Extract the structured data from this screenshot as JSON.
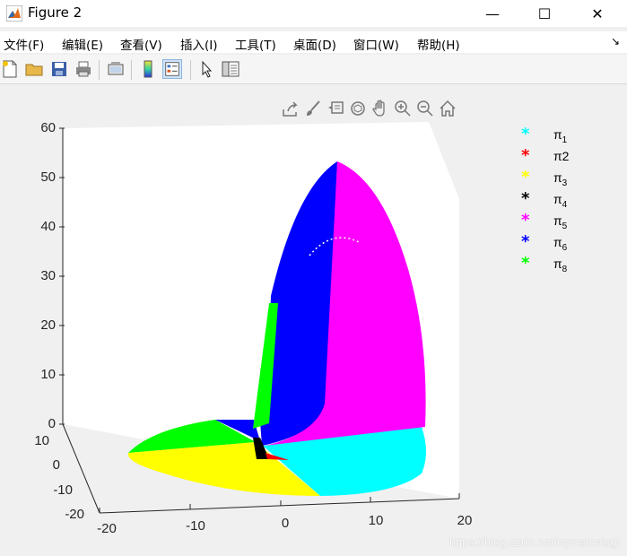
{
  "window": {
    "title": "Figure 2",
    "minimize": "—",
    "maximize": "☐",
    "close": "✕"
  },
  "menubar": {
    "items": [
      {
        "label": "文件(F)"
      },
      {
        "label": "编辑(E)"
      },
      {
        "label": "查看(V)"
      },
      {
        "label": "插入(I)"
      },
      {
        "label": "工具(T)"
      },
      {
        "label": "桌面(D)"
      },
      {
        "label": "窗口(W)"
      },
      {
        "label": "帮助(H)"
      }
    ],
    "dock_arrow": "↘"
  },
  "toolbar": {
    "icons": [
      "new-figure-icon",
      "open-file-icon",
      "save-icon",
      "print-icon",
      "link-plot-icon",
      "colorbar-icon",
      "legend-icon",
      "pointer-icon",
      "property-inspector-icon"
    ]
  },
  "axes_toolbar": {
    "icons": [
      "export-icon",
      "brush-icon",
      "data-tips-icon",
      "rotate-3d-icon",
      "pan-icon",
      "zoom-in-icon",
      "zoom-out-icon",
      "home-icon"
    ]
  },
  "axes": {
    "z_ticks": [
      "60",
      "50",
      "40",
      "30",
      "20",
      "10",
      "0"
    ],
    "y_ticks": [
      "10",
      "0",
      "-10",
      "-20"
    ],
    "x_ticks": [
      "-20",
      "-10",
      "0",
      "10",
      "20"
    ]
  },
  "chart_data": {
    "type": "scatter",
    "z_range": [
      0,
      60
    ],
    "y_range": [
      -20,
      10
    ],
    "x_range": [
      -20,
      20
    ],
    "series": [
      {
        "name": "π1",
        "color": "#00ffff",
        "marker": "*"
      },
      {
        "name": "π2",
        "color": "#ff0000",
        "marker": "*"
      },
      {
        "name": "π3",
        "color": "#ffff00",
        "marker": "*"
      },
      {
        "name": "π4",
        "color": "#000000",
        "marker": "*"
      },
      {
        "name": "π5",
        "color": "#ff00ff",
        "marker": "*"
      },
      {
        "name": "π6",
        "color": "#0000ff",
        "marker": "*"
      },
      {
        "name": "π8",
        "color": "#00ff00",
        "marker": "*"
      }
    ]
  },
  "legend": {
    "entries": [
      {
        "symbol": "π",
        "sub": "1",
        "plain": "",
        "color": "#00ffff"
      },
      {
        "symbol": "π2",
        "sub": "",
        "plain": "",
        "color": "#ff0000"
      },
      {
        "symbol": "π",
        "sub": "3",
        "plain": "",
        "color": "#ffff00"
      },
      {
        "symbol": "π",
        "sub": "4",
        "plain": "",
        "color": "#000000"
      },
      {
        "symbol": "π",
        "sub": "5",
        "plain": "",
        "color": "#ff00ff"
      },
      {
        "symbol": "π",
        "sub": "6",
        "plain": "",
        "color": "#0000ff"
      },
      {
        "symbol": "π",
        "sub": "8",
        "plain": "",
        "color": "#00ff00"
      }
    ],
    "marker": "*"
  },
  "watermark": "https://blog.csdn.net/mynameisgt"
}
